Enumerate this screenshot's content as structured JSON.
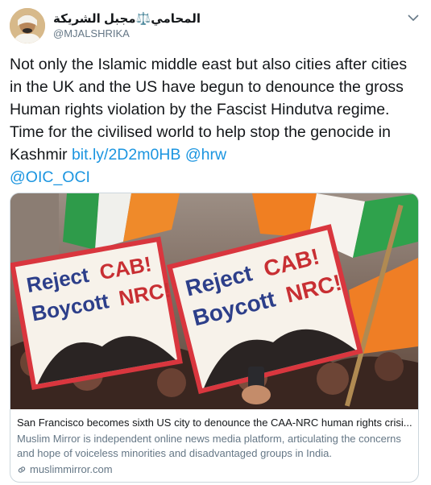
{
  "author": {
    "display_name": "المحامي⚖️مجبل الشريكة",
    "handle": "@MJALSHRIKA"
  },
  "icons": {
    "avatar": "profile-photo",
    "caret": "chevron-down-icon",
    "link": "link-icon"
  },
  "tweet": {
    "text": "Not only the Islamic middle east but also cities after cities in the UK and the US have begun to denounce the gross Human rights violation by the Fascist Hindutva regime. Time for the civilised world to help stop the genocide in Kashmir ",
    "link_url": "bit.ly/2D2m0HB",
    "mention_1": "@hrw",
    "mention_2": "@OIC_OCI"
  },
  "card": {
    "sign_line_1_word_1": "Reject",
    "sign_line_1_word_2": "CAB!",
    "sign_line_2_word_1": "Boycott",
    "sign_line_2_word_2": "NRC!",
    "title": "San Francisco becomes sixth US city to denounce the CAA-NRC human rights crisi...",
    "description": "Muslim Mirror is independent online news media platform, articulating the concerns and hope of voiceless minorities and disadvantaged groups in India.",
    "domain": "muslimmirror.com"
  },
  "colors": {
    "link": "#1b95e0",
    "secondary_text": "#657786",
    "border": "#ccd6dd"
  }
}
